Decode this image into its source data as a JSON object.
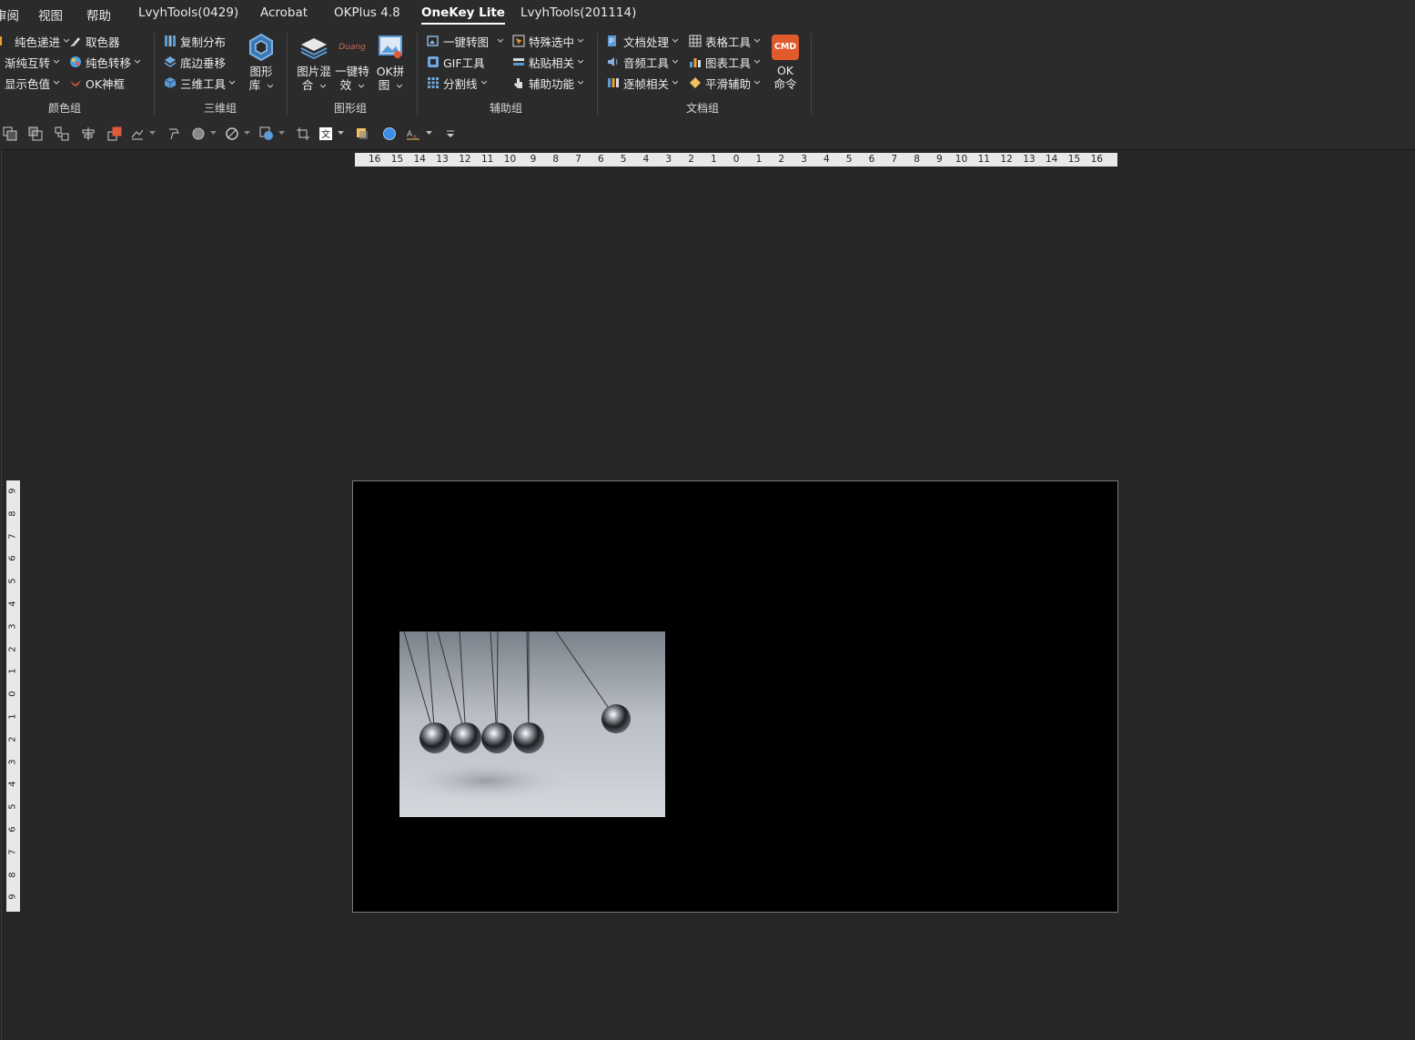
{
  "tabs": [
    {
      "label": "审阅"
    },
    {
      "label": "视图"
    },
    {
      "label": "帮助"
    },
    {
      "label": "LvyhTools(0429)"
    },
    {
      "label": "Acrobat"
    },
    {
      "label": "OKPlus 4.8"
    },
    {
      "label": "OneKey Lite",
      "active": true
    },
    {
      "label": "LvyhTools(201114)"
    }
  ],
  "ribbon": {
    "color_group": {
      "label": "颜色组",
      "items": [
        "纯色递进",
        "渐纯互转",
        "显示色值",
        "取色器",
        "纯色转移",
        "OK神框"
      ]
    },
    "threed_group": {
      "label": "三维组",
      "items": [
        "复制分布",
        "底边垂移",
        "三维工具"
      ],
      "big": {
        "line1": "图形",
        "line2": "库"
      }
    },
    "image_group": {
      "label": "图形组",
      "big": [
        {
          "line1": "图片混",
          "line2": "合"
        },
        {
          "line1": "一键特",
          "line2": "效"
        },
        {
          "line1": "OK拼",
          "line2": "图"
        }
      ],
      "duang_text": "Duang"
    },
    "aux_group": {
      "label": "辅助组",
      "items": [
        "一键转图",
        "GIF工具",
        "分割线",
        "特殊选中",
        "粘贴相关",
        "辅助功能"
      ]
    },
    "doc_group": {
      "label": "文档组",
      "items": [
        "文档处理",
        "音频工具",
        "逐帧相关",
        "表格工具",
        "图表工具",
        "平滑辅助"
      ],
      "cmd": {
        "icon_text": "CMD",
        "line1": "OK",
        "line2": "命令"
      }
    }
  },
  "ruler": {
    "horizontal": [
      "16",
      "15",
      "14",
      "13",
      "12",
      "11",
      "10",
      "9",
      "8",
      "7",
      "6",
      "5",
      "4",
      "3",
      "2",
      "1",
      "0",
      "1",
      "2",
      "3",
      "4",
      "5",
      "6",
      "7",
      "8",
      "9",
      "10",
      "11",
      "12",
      "13",
      "14",
      "15",
      "16"
    ],
    "vertical": [
      "9",
      "8",
      "7",
      "6",
      "5",
      "4",
      "3",
      "2",
      "1",
      "0",
      "1",
      "2",
      "3",
      "4",
      "5",
      "6",
      "7",
      "8",
      "9"
    ]
  },
  "colors": {
    "accent_cmd": "#e05a2b",
    "slide_bg": "#000000",
    "canvas_bg": "#262626"
  },
  "slide": {
    "image_subject": "newtons-cradle-photo"
  }
}
